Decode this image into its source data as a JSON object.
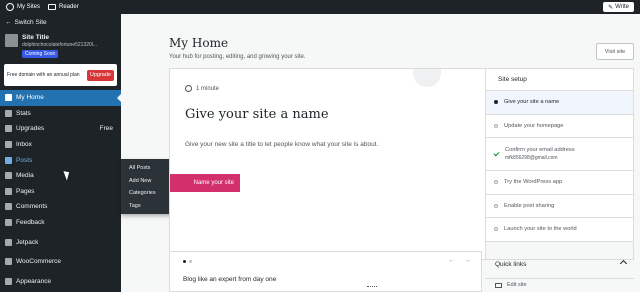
{
  "topbar": {
    "my_sites": "My Sites",
    "reader": "Reader",
    "write": "Write"
  },
  "sidebar": {
    "switch_site": "Switch Site",
    "site_title": "Site Title",
    "site_url": "dolphinchocolatefortune521320l...",
    "coming_soon": "Coming Soon",
    "upsell_text": "Free domain with an annual plan",
    "upgrade": "Upgrade",
    "items": [
      {
        "label": "My Home",
        "icon": "home-icon"
      },
      {
        "label": "Stats",
        "icon": "stats-icon"
      },
      {
        "label": "Upgrades",
        "icon": "upgrades-icon",
        "badge": "Free"
      },
      {
        "label": "Inbox",
        "icon": "inbox-icon"
      },
      {
        "label": "Posts",
        "icon": "pin-icon"
      },
      {
        "label": "Media",
        "icon": "media-icon"
      },
      {
        "label": "Pages",
        "icon": "pages-icon"
      },
      {
        "label": "Comments",
        "icon": "comments-icon"
      },
      {
        "label": "Feedback",
        "icon": "feedback-icon"
      },
      {
        "label": "Jetpack",
        "icon": "jetpack-icon"
      },
      {
        "label": "WooCommerce",
        "icon": "woocommerce-icon"
      },
      {
        "label": "Appearance",
        "icon": "appearance-icon"
      }
    ],
    "flyout": [
      "All Posts",
      "Add New",
      "Categories",
      "Tags"
    ]
  },
  "main": {
    "title": "My Home",
    "subtitle": "Your hub for posting, editing, and growing your site.",
    "visit_site": "Visit site",
    "task": {
      "duration": "1 minute",
      "title": "Give your site a name",
      "description": "Give your new site a title to let people know what your site is about.",
      "button": "Name your site"
    },
    "setup": {
      "heading": "Site setup",
      "steps": [
        {
          "label": "Give your site a name",
          "state": "current"
        },
        {
          "label": "Update your homepage",
          "state": "todo"
        },
        {
          "label": "Confirm your email address",
          "sub": "mfk856298@gmail.com",
          "state": "done"
        },
        {
          "label": "Try the WordPress app",
          "state": "todo"
        },
        {
          "label": "Enable post sharing",
          "state": "todo"
        },
        {
          "label": "Launch your site to the world",
          "state": "todo"
        }
      ]
    },
    "blog_card": {
      "title": "Blog like an expert from day one",
      "prev": "←",
      "next": "→"
    },
    "quick_links": {
      "heading": "Quick links",
      "edit_site": "Edit site"
    }
  }
}
